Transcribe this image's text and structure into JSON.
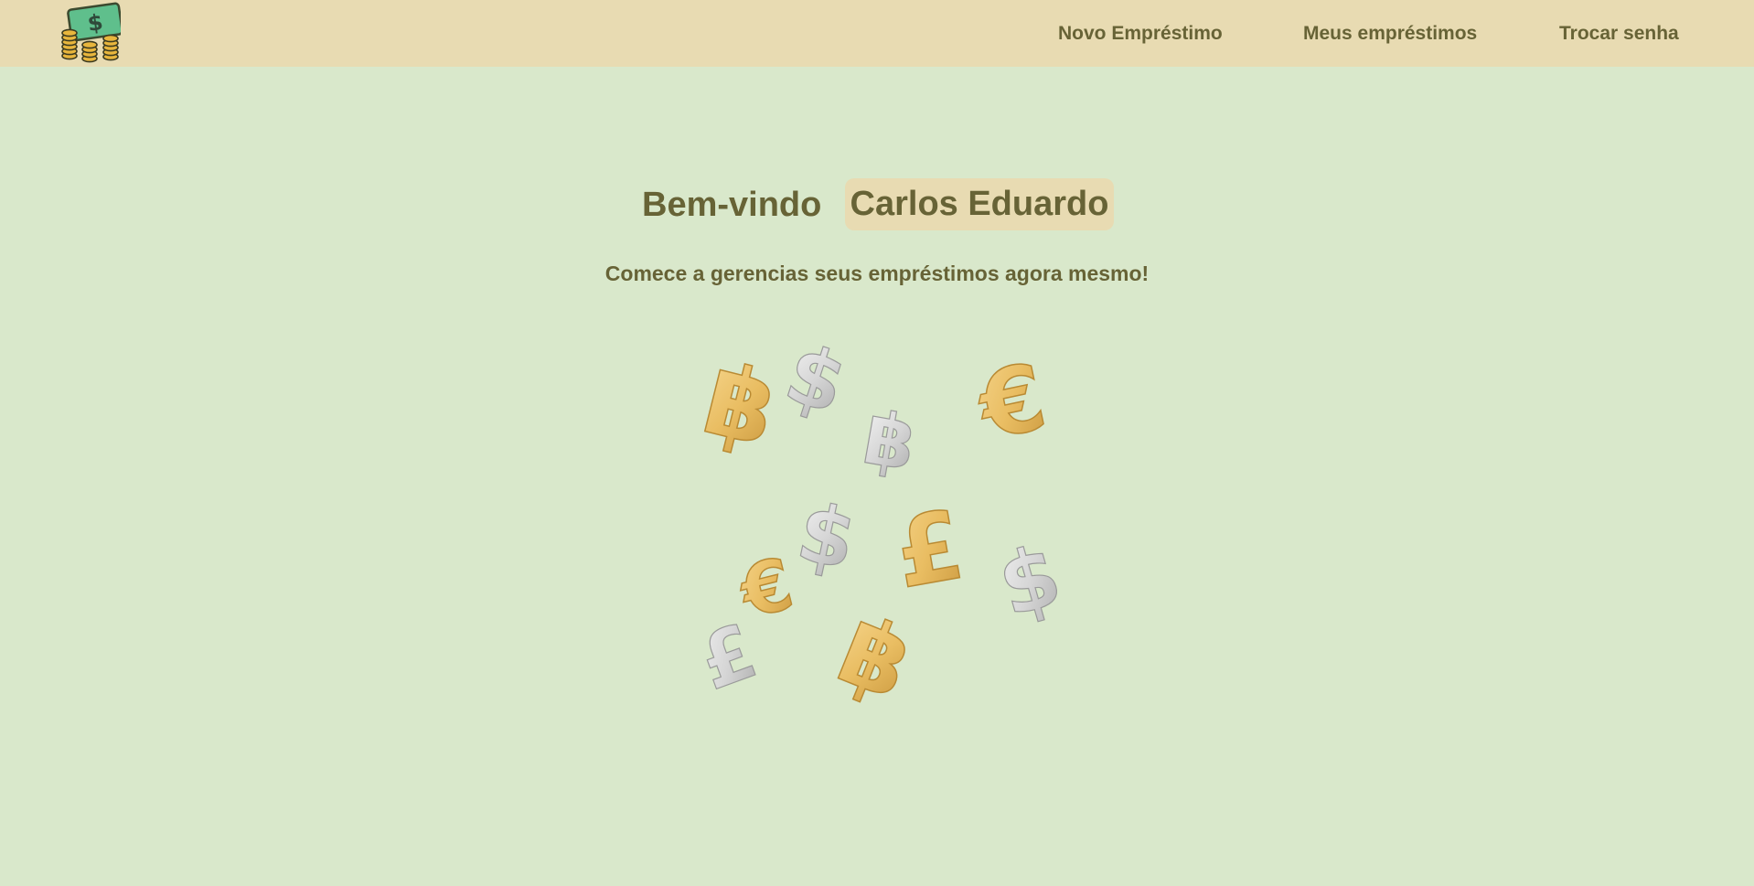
{
  "header": {
    "logo_icon": "money-coins-icon",
    "nav": [
      {
        "label": "Novo Empréstimo"
      },
      {
        "label": "Meus empréstimos"
      },
      {
        "label": "Trocar senha"
      }
    ]
  },
  "main": {
    "welcome": "Bem-vindo",
    "user_name": "Carlos Eduardo",
    "subtitle": "Comece a gerencias seus empréstimos agora mesmo!",
    "illustration_icon": "currency-symbols-illustration"
  },
  "colors": {
    "header_bg": "#e8dbb2",
    "page_bg": "#d9e8cb",
    "text": "#676336",
    "gold": "#e8bd62",
    "silver": "#d7d7d7"
  }
}
